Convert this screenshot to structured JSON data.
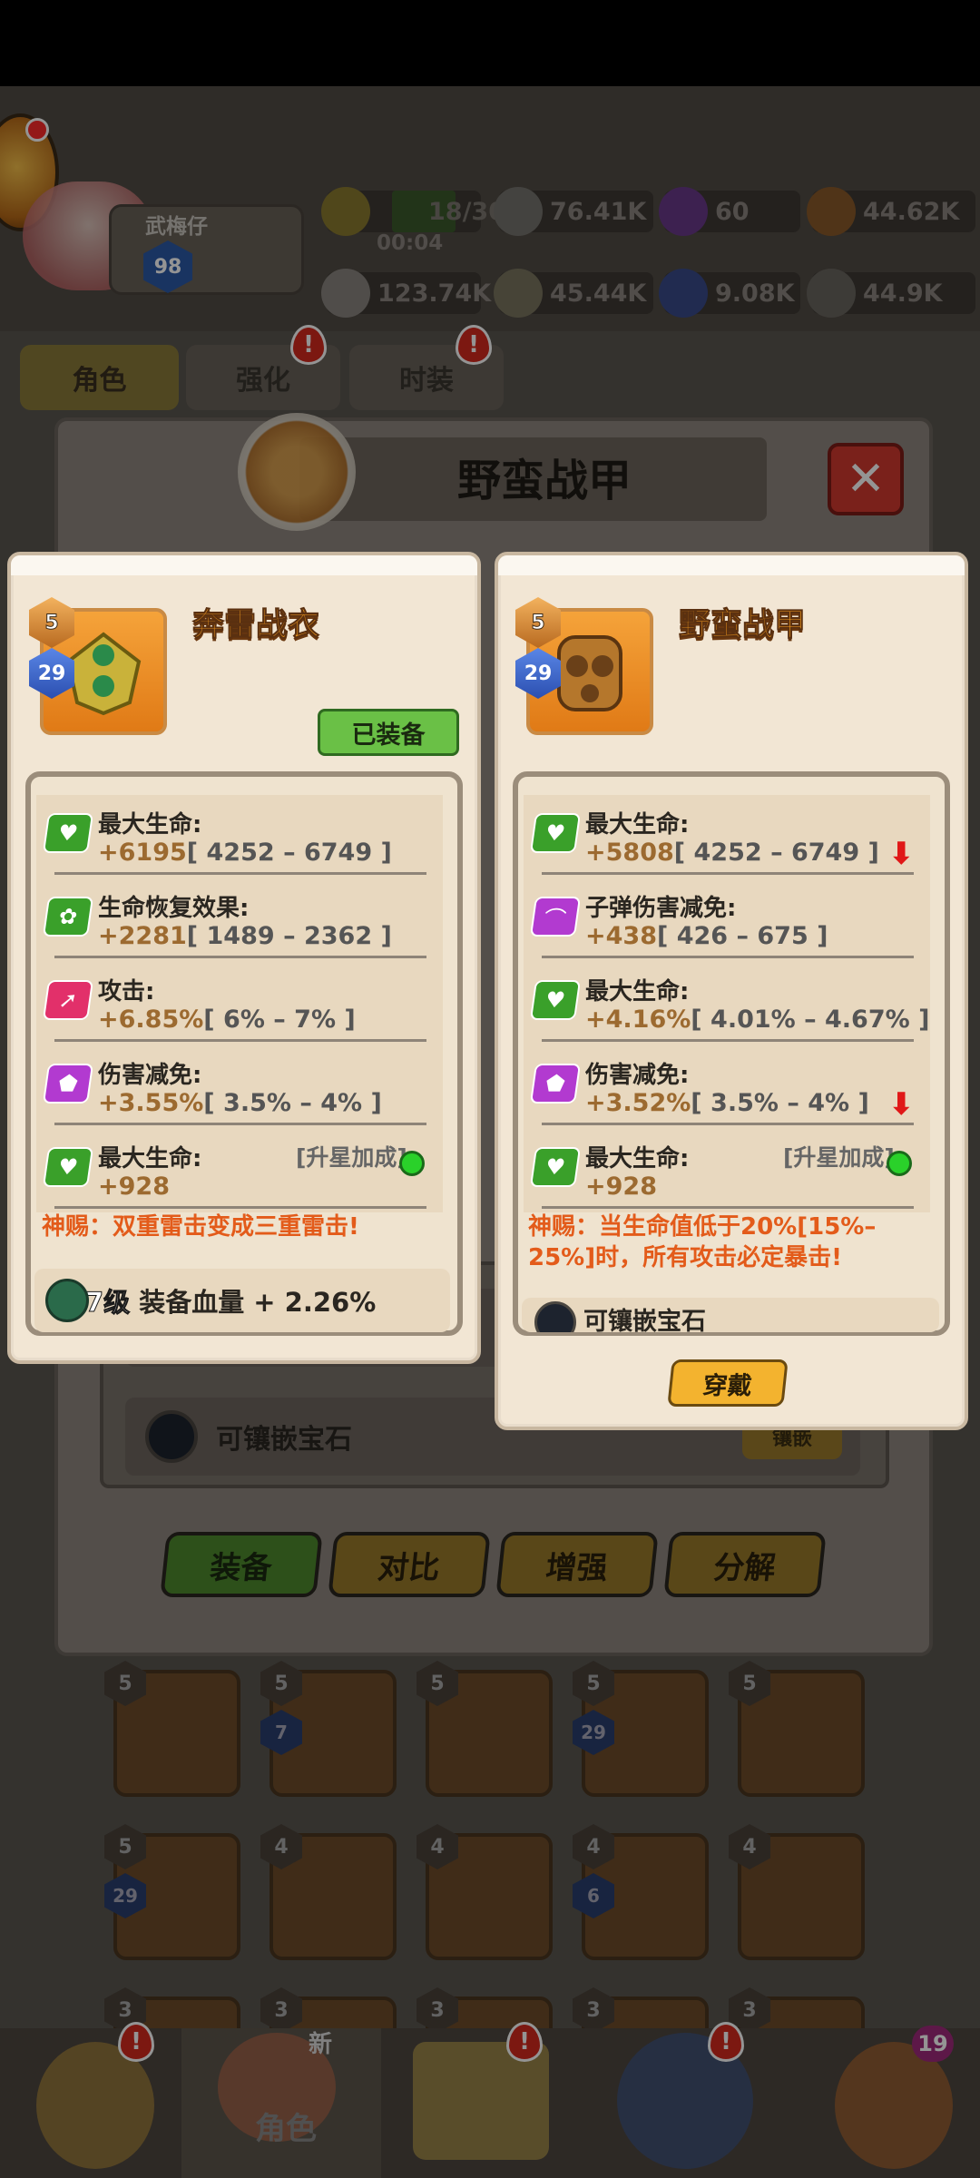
{
  "header": {
    "player_name": "武梅仔",
    "player_level": "98",
    "energy": "18/30",
    "energy_timer": "00:04",
    "resources": [
      "76.41K",
      "60",
      "44.62K",
      "123.74K",
      "45.44K",
      "9.08K",
      "44.9K"
    ]
  },
  "tabs": [
    {
      "label": "角色",
      "selected": true
    },
    {
      "label": "强化",
      "badge": "!"
    },
    {
      "label": "时装",
      "badge": "!"
    }
  ],
  "back_panel": {
    "title": "野蛮战甲",
    "gem_slot_label": "可镶嵌宝石",
    "gem_button_label": "镶嵌",
    "actions": [
      "装备",
      "对比",
      "增强",
      "分解"
    ]
  },
  "left_card": {
    "item_name": "奔雷战衣",
    "stars": "5",
    "level": "29",
    "status_button": "已装备",
    "stats": [
      {
        "icon": "heart-icon",
        "label": "最大生命:",
        "value": "+6195",
        "range": "[ 4252 – 6749 ]"
      },
      {
        "icon": "regen-icon",
        "label": "生命恢复效果:",
        "value": "+2281",
        "range": "[ 1489 – 2362 ]"
      },
      {
        "icon": "attack-icon",
        "label": "攻击:",
        "value": "+6.85%",
        "range": "[ 6% – 7% ]"
      },
      {
        "icon": "shield-icon",
        "label": "伤害减免:",
        "value": "+3.55%",
        "range": "[ 3.5% – 4% ]"
      },
      {
        "icon": "heart-icon",
        "label": "最大生命:",
        "label2": "[升星加成]",
        "value": "+928"
      }
    ],
    "divine_text": "神赐：双重雷击变成三重雷击!",
    "bonus_level": "7级",
    "bonus_text": "装备血量 + 2.26%"
  },
  "right_card": {
    "item_name": "野蛮战甲",
    "stars": "5",
    "level": "29",
    "stats": [
      {
        "icon": "heart-icon",
        "label": "最大生命:",
        "value": "+5808",
        "range": "[ 4252 – 6749 ]",
        "down": true
      },
      {
        "icon": "bullet-shield-icon",
        "label": "子弹伤害减免:",
        "value": "+438",
        "range": "[ 426 – 675 ]"
      },
      {
        "icon": "heart-icon",
        "label": "最大生命:",
        "value": "+4.16%",
        "range": "[ 4.01% – 4.67% ]"
      },
      {
        "icon": "shield-icon",
        "label": "伤害减免:",
        "value": "+3.52%",
        "range": "[ 3.5% – 4% ]",
        "down": true
      },
      {
        "icon": "heart-icon",
        "label": "最大生命:",
        "label2": "[升星加成]",
        "value": "+928"
      }
    ],
    "divine_text": "神赐：当生命值低于20%[15%–25%]时，所有攻击必定暴击!",
    "gem_slot_label": "可镶嵌宝石",
    "wear_button": "穿戴"
  },
  "grid": [
    {
      "stars": "5"
    },
    {
      "stars": "5",
      "level": "7"
    },
    {
      "stars": "5"
    },
    {
      "stars": "5",
      "level": "29"
    },
    {
      "stars": "5"
    },
    {
      "stars": "5",
      "level": "29"
    },
    {
      "stars": "4"
    },
    {
      "stars": "4"
    },
    {
      "stars": "4",
      "level": "6"
    },
    {
      "stars": "4"
    },
    {
      "stars": "3"
    },
    {
      "stars": "3"
    },
    {
      "stars": "3"
    },
    {
      "stars": "3"
    },
    {
      "stars": "3"
    }
  ],
  "bottom_nav": {
    "selected_label": "角色",
    "new_badge": "新",
    "count_badge": "19"
  }
}
